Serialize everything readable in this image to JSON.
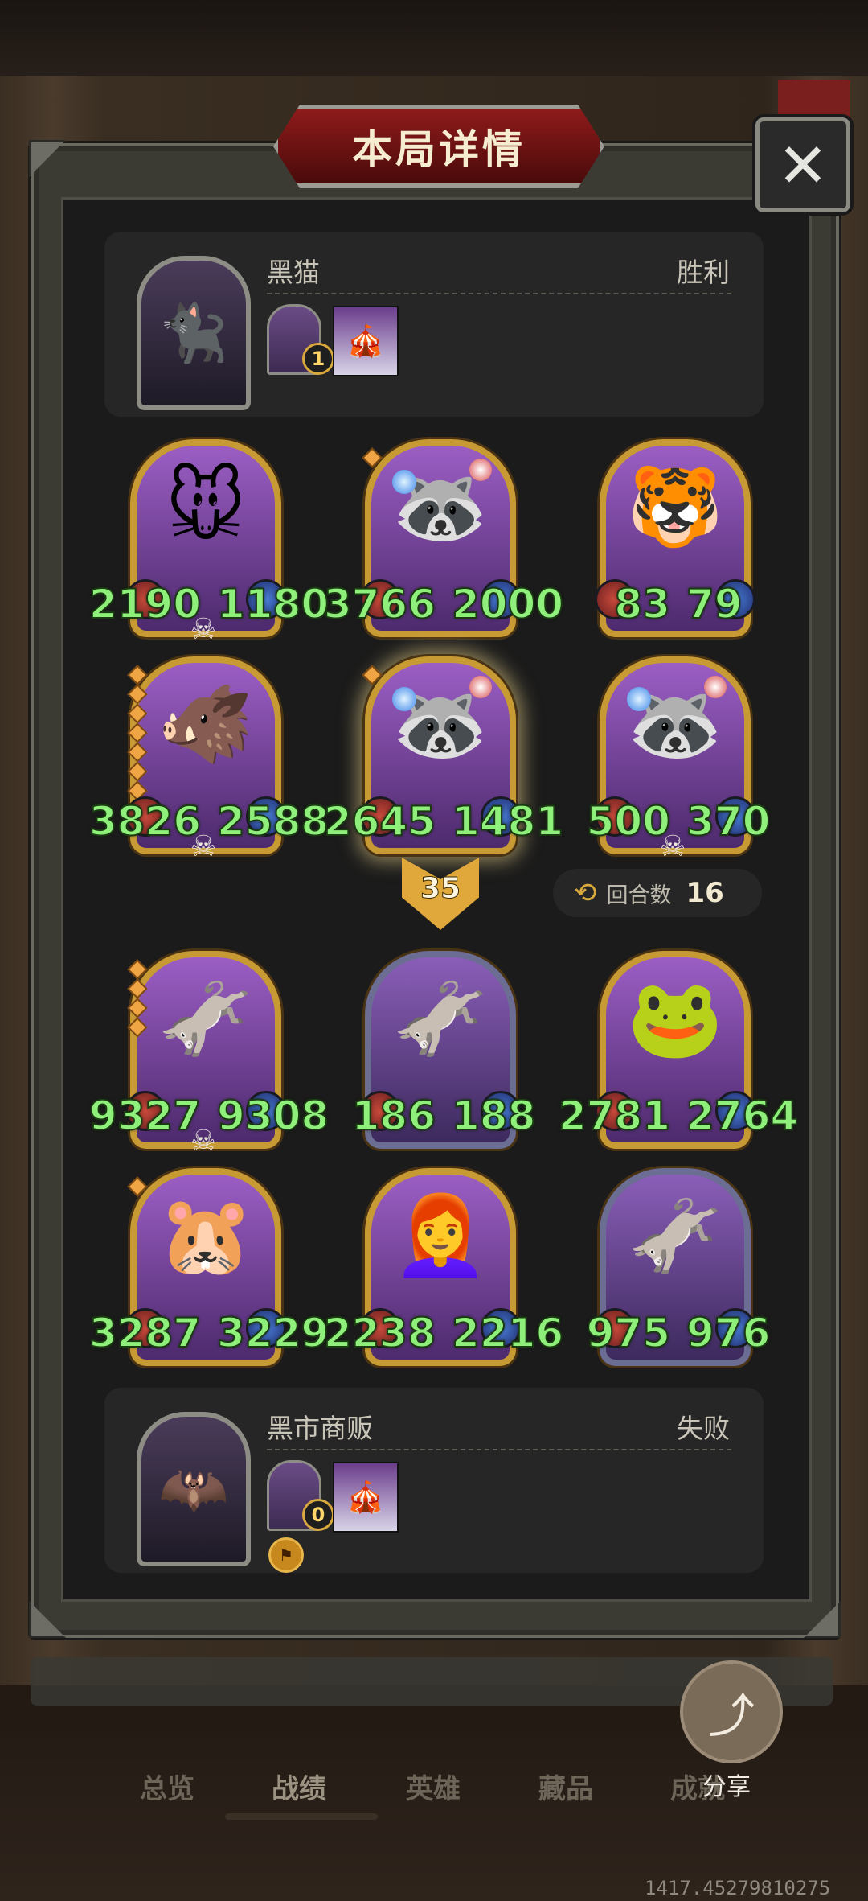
{
  "title": "本局详情",
  "close_symbol": "✕",
  "top_player": {
    "name": "黑猫",
    "result": "胜利",
    "avatar_emoji": "🐈‍⬛",
    "coin_value": "1",
    "item_emoji": "🎪"
  },
  "top_board": [
    {
      "art": "🐭",
      "atk": "2190",
      "hp": "1180",
      "frame": "gold",
      "skull": true,
      "pips": 0,
      "gems": false
    },
    {
      "art": "🦝",
      "atk": "3766",
      "hp": "2000",
      "frame": "gold",
      "skull": false,
      "pips": 1,
      "gems": true
    },
    {
      "art": "🐯",
      "atk": "83",
      "hp": "79",
      "frame": "gold",
      "skull": false,
      "pips": 0,
      "gems": false
    },
    {
      "art": "🐗",
      "atk": "3826",
      "hp": "2588",
      "frame": "gold",
      "skull": true,
      "pips": 7,
      "gems": false
    },
    {
      "art": "🦝",
      "atk": "2645",
      "hp": "1481",
      "frame": "gold",
      "skull": false,
      "pips": 1,
      "gems": true,
      "glow": true
    },
    {
      "art": "🦝",
      "atk": "500",
      "hp": "370",
      "frame": "gold",
      "skull": true,
      "pips": 0,
      "gems": true
    }
  ],
  "tier": "35",
  "rounds": {
    "icon": "⟲",
    "label": "回合数",
    "value": "16"
  },
  "bottom_board": [
    {
      "art": "🫏",
      "atk": "9327",
      "hp": "9308",
      "frame": "gold",
      "skull": true,
      "pips": 4,
      "gems": false
    },
    {
      "art": "🫏",
      "atk": "186",
      "hp": "188",
      "frame": "silver",
      "skull": false,
      "pips": 0,
      "gems": false
    },
    {
      "art": "🐸",
      "atk": "2781",
      "hp": "2764",
      "frame": "gold",
      "skull": false,
      "pips": 0,
      "gems": false
    },
    {
      "art": "🐹",
      "atk": "3287",
      "hp": "3229",
      "frame": "gold",
      "skull": false,
      "pips": 1,
      "gems": false
    },
    {
      "art": "👩‍🦰",
      "atk": "2238",
      "hp": "2216",
      "frame": "gold",
      "skull": false,
      "pips": 0,
      "gems": false
    },
    {
      "art": "🫏",
      "atk": "975",
      "hp": "976",
      "frame": "silver",
      "skull": false,
      "pips": 0,
      "gems": false
    }
  ],
  "bottom_player": {
    "name": "黑市商贩",
    "result": "失败",
    "avatar_emoji": "🦇",
    "coin_value": "0",
    "item_emoji": "🎪",
    "badge_symbol": "⚑"
  },
  "nav": {
    "items": [
      "总览",
      "战绩",
      "英雄",
      "藏品",
      "成就"
    ],
    "active": "战绩"
  },
  "share": {
    "icon": "⤴",
    "label": "分享"
  },
  "coordinate": "1417.45279810275",
  "colors": {
    "stat_green": "#8ef07a",
    "gold_frame": "#c89a34",
    "banner_red": "#8e1b1b"
  }
}
